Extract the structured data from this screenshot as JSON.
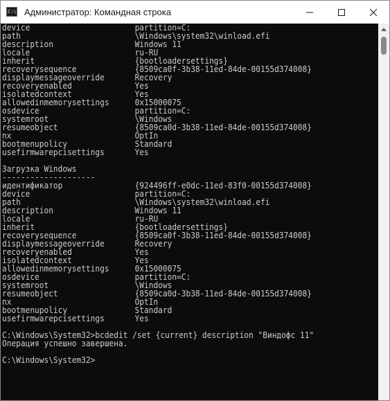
{
  "window": {
    "title": "Администратор: Командная строка",
    "app_icon_glyph": "C:\\"
  },
  "console": {
    "lines": [
      {
        "key": "device",
        "value": "partition=C:"
      },
      {
        "key": "path",
        "value": "\\Windows\\system32\\winload.efi"
      },
      {
        "key": "description",
        "value": "Windows 11"
      },
      {
        "key": "locale",
        "value": "ru-RU"
      },
      {
        "key": "inherit",
        "value": "{bootloadersettings}"
      },
      {
        "key": "recoverysequence",
        "value": "{8509ca0f-3b38-11ed-84de-00155d374008}"
      },
      {
        "key": "displaymessageoverride",
        "value": "Recovery"
      },
      {
        "key": "recoveryenabled",
        "value": "Yes"
      },
      {
        "key": "isolatedcontext",
        "value": "Yes"
      },
      {
        "key": "allowedinmemorysettings",
        "value": "0x15000075"
      },
      {
        "key": "osdevice",
        "value": "partition=C:"
      },
      {
        "key": "systemroot",
        "value": "\\Windows"
      },
      {
        "key": "resumeobject",
        "value": "{8509ca0d-3b38-11ed-84de-00155d374008}"
      },
      {
        "key": "nx",
        "value": "OptIn"
      },
      {
        "key": "bootmenupolicy",
        "value": "Standard"
      },
      {
        "key": "usefirmwarepcisettings",
        "value": "Yes"
      },
      {
        "key": "",
        "value": ""
      },
      {
        "key": "Загрузка Windows",
        "value": ""
      },
      {
        "key": "--------------------",
        "value": ""
      },
      {
        "key": "идентификатор",
        "value": "{924496ff-e0dc-11ed-83f0-00155d374008}"
      },
      {
        "key": "device",
        "value": "partition=C:"
      },
      {
        "key": "path",
        "value": "\\Windows\\system32\\winload.efi"
      },
      {
        "key": "description",
        "value": "Windows 11"
      },
      {
        "key": "locale",
        "value": "ru-RU"
      },
      {
        "key": "inherit",
        "value": "{bootloadersettings}"
      },
      {
        "key": "recoverysequence",
        "value": "{8509ca0f-3b38-11ed-84de-00155d374008}"
      },
      {
        "key": "displaymessageoverride",
        "value": "Recovery"
      },
      {
        "key": "recoveryenabled",
        "value": "Yes"
      },
      {
        "key": "isolatedcontext",
        "value": "Yes"
      },
      {
        "key": "allowedinmemorysettings",
        "value": "0x15000075"
      },
      {
        "key": "osdevice",
        "value": "partition=C:"
      },
      {
        "key": "systemroot",
        "value": "\\Windows"
      },
      {
        "key": "resumeobject",
        "value": "{8509ca0d-3b38-11ed-84de-00155d374008}"
      },
      {
        "key": "nx",
        "value": "OptIn"
      },
      {
        "key": "bootmenupolicy",
        "value": "Standard"
      },
      {
        "key": "usefirmwarepcisettings",
        "value": "Yes"
      },
      {
        "key": "",
        "value": ""
      },
      {
        "key": "C:\\Windows\\System32>bcdedit /set {current} description \"Виндофс 11\"",
        "value": ""
      },
      {
        "key": "Операция успешно завершена.",
        "value": ""
      },
      {
        "key": "",
        "value": ""
      },
      {
        "key": "C:\\Windows\\System32>",
        "value": ""
      }
    ]
  },
  "colors": {
    "console_bg": "#0c0c0c",
    "console_fg": "#cccccc",
    "titlebar_bg": "#ffffff",
    "scrollbar_bg": "#f0f0f0"
  }
}
